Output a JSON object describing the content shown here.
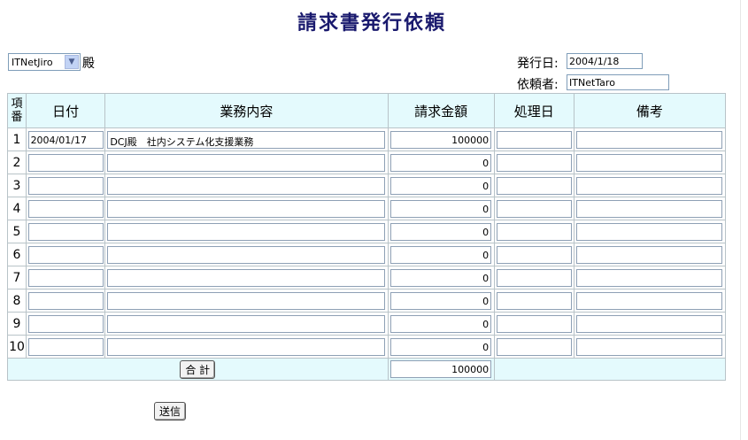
{
  "page": {
    "title": "請求書発行依頼"
  },
  "recipient": {
    "selected": "ITNetJiro",
    "suffix": "殿"
  },
  "header": {
    "issue_date_label": "発行日:",
    "issue_date_value": "2004/1/18",
    "requester_label": "依頼者:",
    "requester_value": "ITNetTaro"
  },
  "table": {
    "columns": [
      "項番",
      "日付",
      "業務内容",
      "請求金額",
      "処理日",
      "備考"
    ],
    "rows": [
      {
        "no": "1",
        "date": "2004/01/17",
        "content": "DCJ殿　社内システム化支援業務",
        "amount": "100000",
        "proc": "",
        "note": ""
      },
      {
        "no": "2",
        "date": "",
        "content": "",
        "amount": "0",
        "proc": "",
        "note": ""
      },
      {
        "no": "3",
        "date": "",
        "content": "",
        "amount": "0",
        "proc": "",
        "note": ""
      },
      {
        "no": "4",
        "date": "",
        "content": "",
        "amount": "0",
        "proc": "",
        "note": ""
      },
      {
        "no": "5",
        "date": "",
        "content": "",
        "amount": "0",
        "proc": "",
        "note": ""
      },
      {
        "no": "6",
        "date": "",
        "content": "",
        "amount": "0",
        "proc": "",
        "note": ""
      },
      {
        "no": "7",
        "date": "",
        "content": "",
        "amount": "0",
        "proc": "",
        "note": ""
      },
      {
        "no": "8",
        "date": "",
        "content": "",
        "amount": "0",
        "proc": "",
        "note": ""
      },
      {
        "no": "9",
        "date": "",
        "content": "",
        "amount": "0",
        "proc": "",
        "note": ""
      },
      {
        "no": "10",
        "date": "",
        "content": "",
        "amount": "0",
        "proc": "",
        "note": ""
      }
    ],
    "total_button": "合 計",
    "total_value": "100000"
  },
  "submit_label": "送信",
  "colors": {
    "title": "#1a1a6e",
    "header_bg": "#e4fafd",
    "grid_line": "#b8c3c8"
  }
}
